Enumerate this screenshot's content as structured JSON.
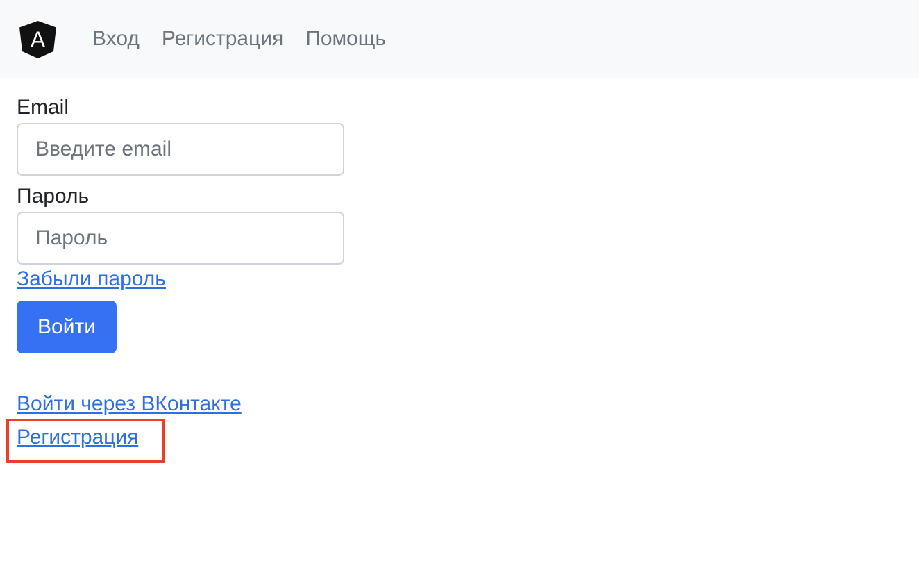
{
  "navbar": {
    "logo_icon": "angular-logo-icon",
    "logo_letter": "A",
    "links": [
      "Вход",
      "Регистрация",
      "Помощь"
    ]
  },
  "form": {
    "email_label": "Email",
    "email_placeholder": "Введите email",
    "email_value": "",
    "password_label": "Пароль",
    "password_placeholder": "Пароль",
    "password_value": "",
    "forgot_link": "Забыли пароль",
    "submit_label": "Войти"
  },
  "social": {
    "vk_link": "Войти через ВКонтакте",
    "register_link": "Регистрация"
  },
  "colors": {
    "primary": "#3571f2",
    "link": "#2f6fe4",
    "highlight": "#e8412a",
    "navbar_bg": "#f8f9fa"
  }
}
